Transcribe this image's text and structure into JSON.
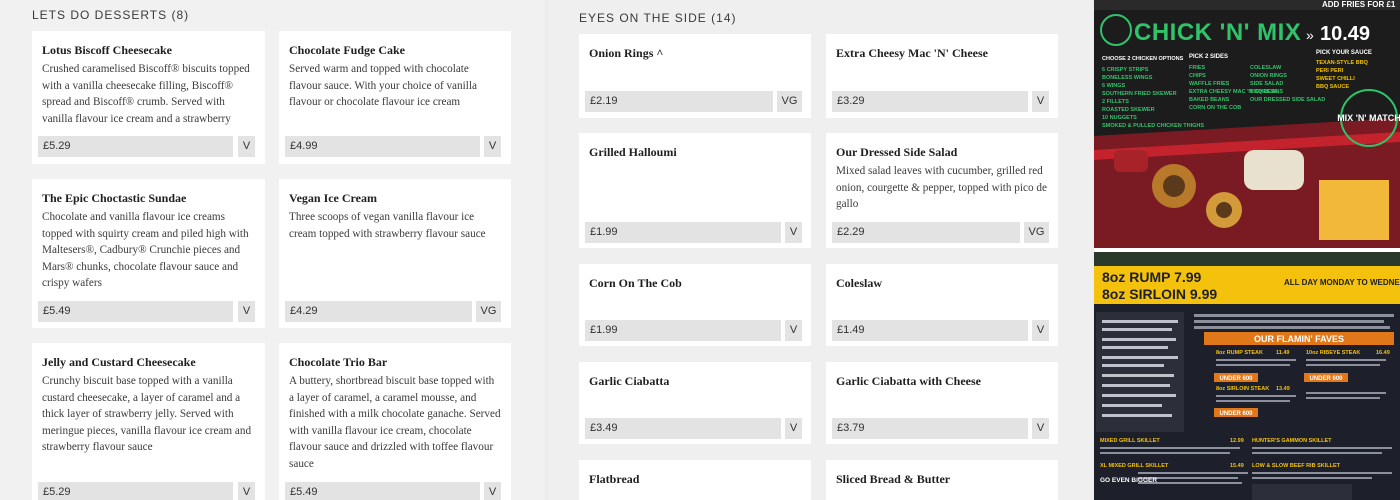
{
  "desserts": {
    "heading": "LETS DO DESSERTS (8)",
    "items": [
      {
        "title": "Lotus Biscoff Cheesecake",
        "desc": "Crushed caramelised Biscoff® biscuits topped with a vanilla cheesecake filling, Biscoff® spread and Biscoff® crumb. Served with vanilla flavour ice cream and a strawberry",
        "price": "£5.29",
        "tag": "V"
      },
      {
        "title": "Chocolate Fudge Cake",
        "desc": "Served warm and topped with chocolate flavour sauce. With your choice of vanilla flavour or chocolate flavour ice cream",
        "price": "£4.99",
        "tag": "V"
      },
      {
        "title": "The Epic Choctastic Sundae",
        "desc": "Chocolate and vanilla flavour ice creams topped with squirty cream and piled high with Maltesers®, Cadbury® Crunchie pieces and Mars® chunks, chocolate flavour sauce and crispy wafers",
        "price": "£5.49",
        "tag": "V"
      },
      {
        "title": "Vegan Ice Cream",
        "desc": "Three scoops of vegan vanilla flavour ice cream topped with strawberry flavour sauce",
        "price": "£4.29",
        "tag": "VG"
      },
      {
        "title": "Jelly and Custard Cheesecake",
        "desc": "Crunchy biscuit base topped with a vanilla custard cheesecake, a layer of caramel and a thick layer of strawberry jelly. Served with meringue pieces, vanilla flavour ice cream and strawberry flavour sauce",
        "price": "£5.29",
        "tag": "V"
      },
      {
        "title": "Chocolate Trio Bar",
        "desc": "A buttery, shortbread biscuit base topped with a layer of caramel, a caramel mousse, and finished with a milk chocolate ganache. Served with vanilla flavour ice cream, chocolate flavour sauce and drizzled with toffee flavour sauce",
        "price": "£5.49",
        "tag": "V"
      }
    ]
  },
  "sides": {
    "heading": "EYES ON THE SIDE (14)",
    "items": [
      {
        "title": "Onion Rings ^",
        "desc": "",
        "price": "£2.19",
        "tag": "VG"
      },
      {
        "title": "Extra Cheesy Mac 'N' Cheese",
        "desc": "",
        "price": "£3.29",
        "tag": "V"
      },
      {
        "title": "Grilled Halloumi",
        "desc": "",
        "price": "£1.99",
        "tag": "V"
      },
      {
        "title": "Our Dressed Side Salad",
        "desc": "Mixed salad leaves with cucumber, grilled red onion, courgette & pepper, topped with pico de gallo",
        "price": "£2.29",
        "tag": "VG"
      },
      {
        "title": "Corn On The Cob",
        "desc": "",
        "price": "£1.99",
        "tag": "V"
      },
      {
        "title": "Coleslaw",
        "desc": "",
        "price": "£1.49",
        "tag": "V"
      },
      {
        "title": "Garlic Ciabatta",
        "desc": "",
        "price": "£3.49",
        "tag": "V"
      },
      {
        "title": "Garlic Ciabatta with Cheese",
        "desc": "",
        "price": "£3.79",
        "tag": "V"
      },
      {
        "title": "Flatbread",
        "desc": "",
        "price": "",
        "tag": ""
      },
      {
        "title": "Sliced Bread & Butter",
        "desc": "",
        "price": "",
        "tag": ""
      }
    ]
  },
  "promo1": {
    "brand": "CHICK 'N' MIX",
    "price": "10.49",
    "top_banner": "ADD FRIES FOR £1",
    "col1_head": "CHOOSE 2 CHICKEN OPTIONS",
    "col1_items": [
      "6 CRISPY STRIPS",
      "BONELESS WINGS",
      "6 WINGS",
      "SOUTHERN FRIED SKEWER",
      "2 FILLETS",
      "ROASTED SKEWER",
      "10 NUGGETS",
      "SMOKED & PULLED CHICKEN THIGHS"
    ],
    "col2_head": "PICK 2 SIDES",
    "col2_items": [
      "FRIES",
      "CHIPS",
      "WAFFLE FRIES",
      "EXTRA CHEESY MAC 'N' CHEESE",
      "BAKED BEANS",
      "CORN ON THE COB"
    ],
    "col3_items": [
      "COLESLAW",
      "ONION RINGS",
      "SIDE SALAD",
      "BBQ BEANS",
      "OUR DRESSED SIDE SALAD"
    ],
    "col4_head": "PICK YOUR SAUCE",
    "col4_items": [
      "TEXAN-STYLE BBQ",
      "PERI PERI",
      "SWEET CHILLI",
      "BBQ SAUCE"
    ],
    "badge": "MIX 'N' MATCH",
    "colors": {
      "bg": "#1b1b1b",
      "accent": "#2fc46a",
      "sauce": "#f2c200",
      "red": "#c4222c"
    }
  },
  "promo2": {
    "line1": "8oz RUMP 7.99",
    "line2": "8oz SIRLOIN 9.99",
    "side_text": "ALL DAY MONDAY TO WEDNESDAY",
    "faves": "OUR FLAMIN' FAVES",
    "under_label": "UNDER 600",
    "steaks": [
      "8oz RUMP STEAK",
      "8oz SIRLOIN STEAK",
      "10oz RIBEYE STEAK"
    ],
    "steak_prices": [
      "11.49",
      "13.49",
      "16.49"
    ],
    "skillets": [
      "MIXED GRILL SKILLET",
      "XL MIXED GRILL SKILLET",
      "HUNTER'S GAMMON SKILLET",
      "LOW & SLOW BEEF RIB SKILLET"
    ],
    "skillet_prices": [
      "12.99",
      "15.49"
    ],
    "bigger_label": "GO EVEN BIGGER",
    "colors": {
      "bg": "#1d1f2a",
      "yellow": "#f4c20d",
      "orange": "#e0781a"
    }
  }
}
